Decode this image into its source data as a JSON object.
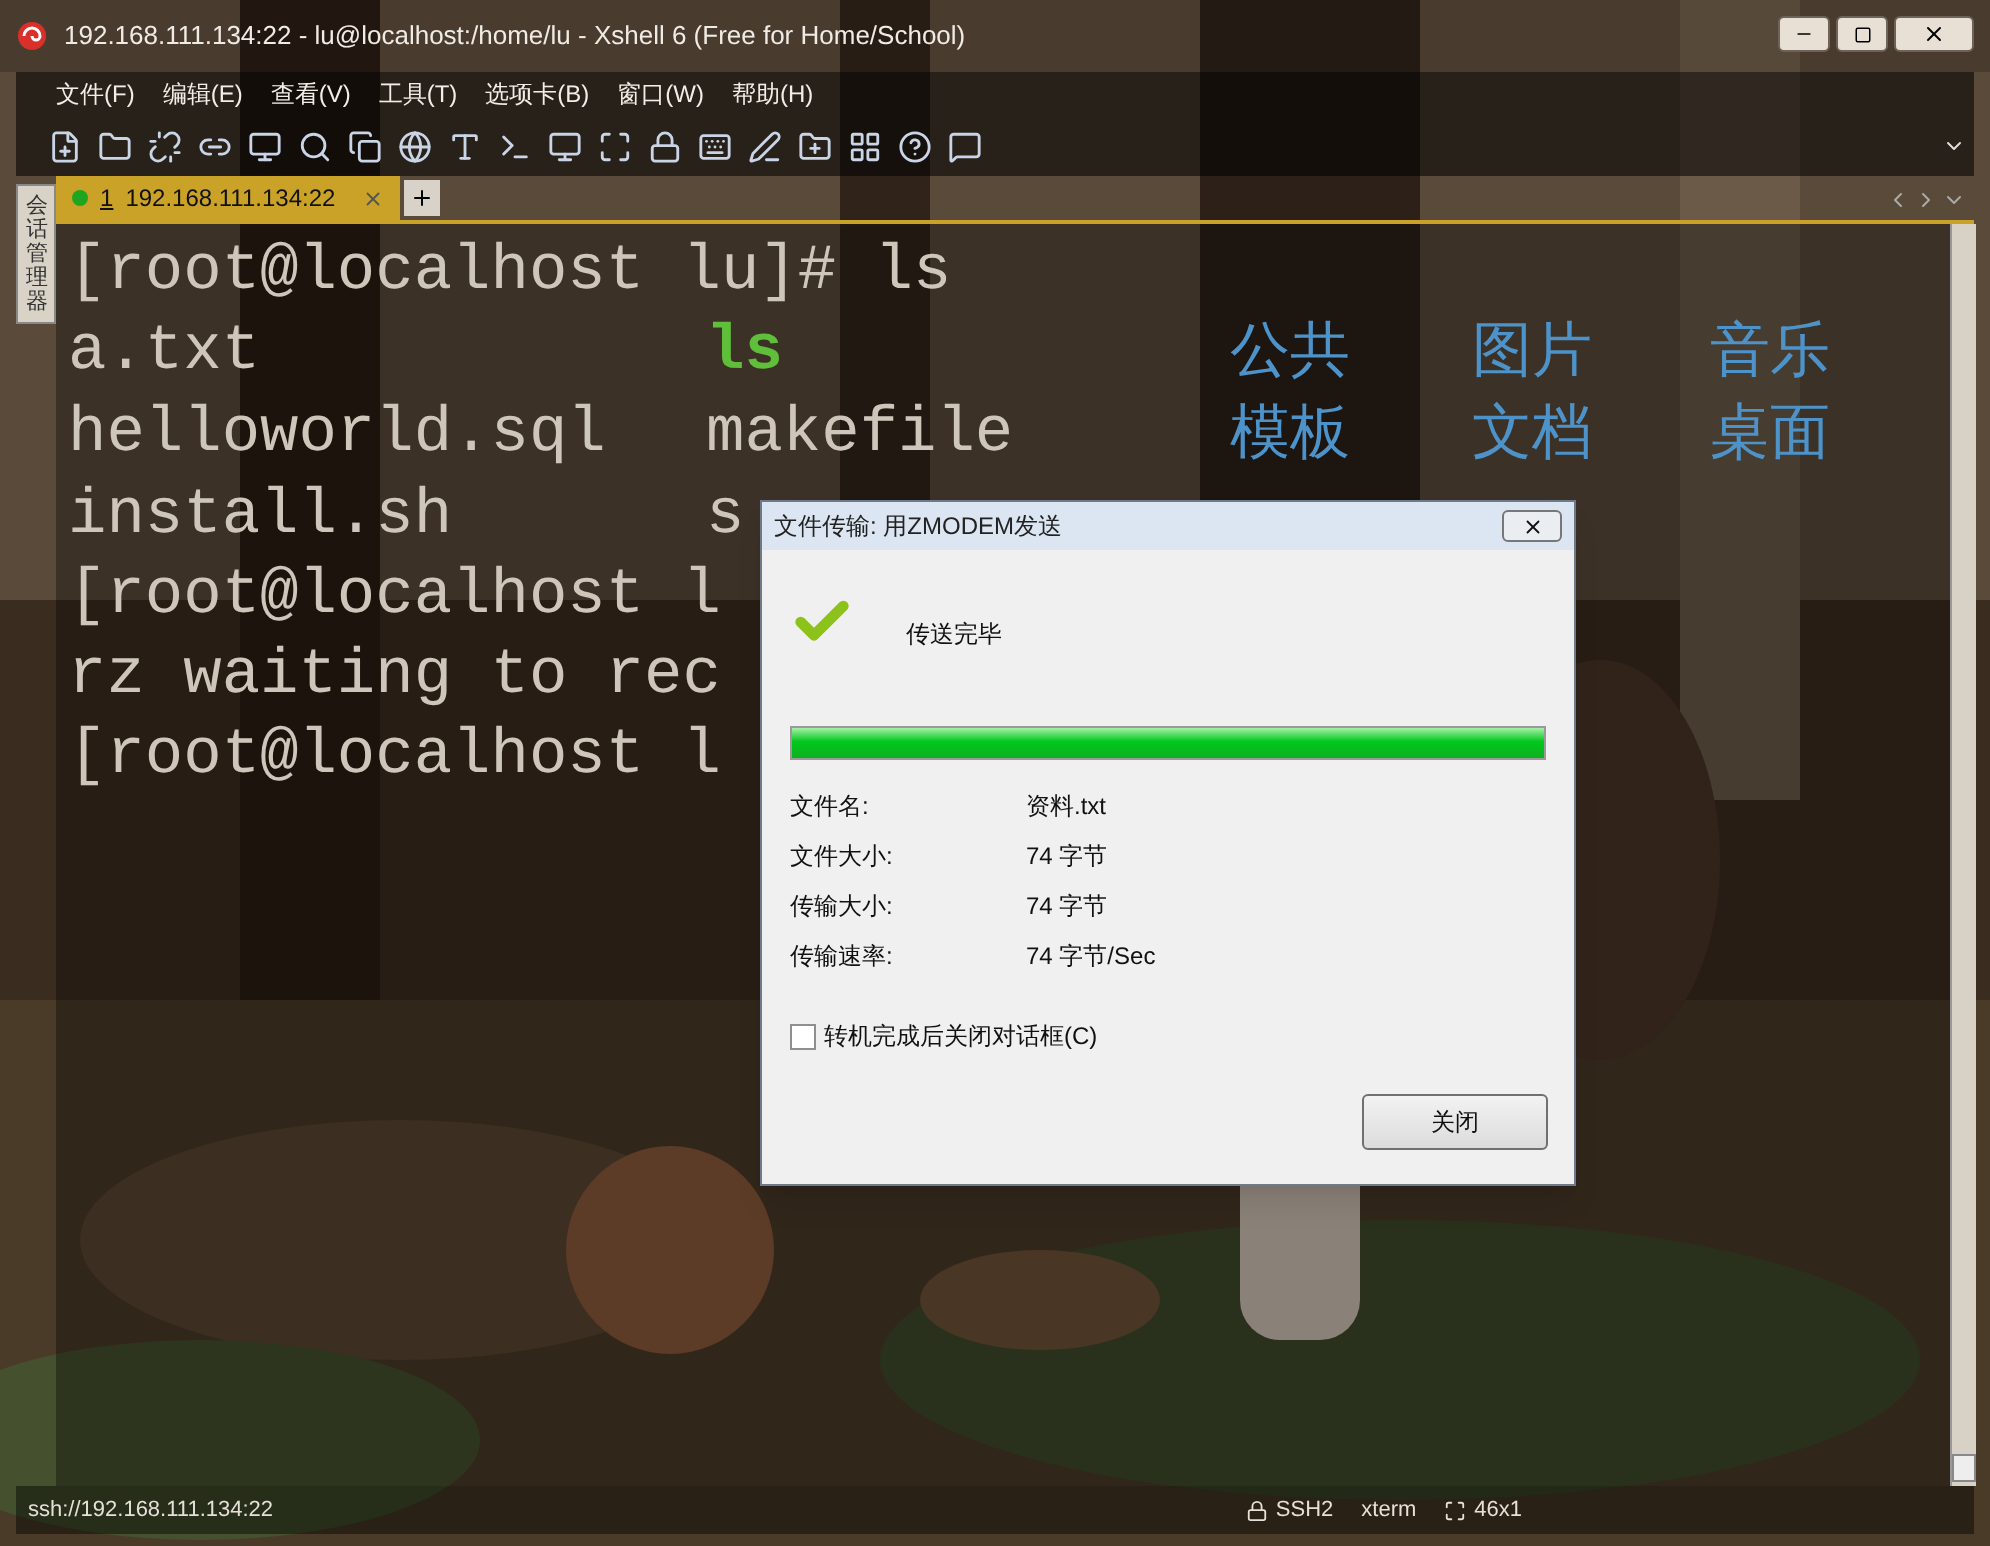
{
  "window": {
    "title": "192.168.111.134:22 - lu@localhost:/home/lu - Xshell 6 (Free for Home/School)"
  },
  "menu": [
    "文件(F)",
    "编辑(E)",
    "查看(V)",
    "工具(T)",
    "选项卡(B)",
    "窗口(W)",
    "帮助(H)"
  ],
  "tabs": [
    {
      "number": "1",
      "label": "192.168.111.134:22",
      "selected": true,
      "connected": true
    }
  ],
  "side_panel": {
    "label": "会话管理器"
  },
  "terminal": {
    "lines": [
      [
        {
          "text": "[root@localhost lu]# ls",
          "kind": "plain"
        }
      ],
      [
        {
          "text": "a.txt",
          "kind": "plain"
        },
        {
          "text": "ls",
          "kind": "exec"
        },
        {
          "text": "公共",
          "kind": "dir"
        },
        {
          "text": "图片",
          "kind": "dir"
        },
        {
          "text": "音乐",
          "kind": "dir"
        }
      ],
      [
        {
          "text": "helloworld.sql",
          "kind": "plain"
        },
        {
          "text": "makefile",
          "kind": "plain"
        },
        {
          "text": "模板",
          "kind": "dir"
        },
        {
          "text": "文档",
          "kind": "dir"
        },
        {
          "text": "桌面",
          "kind": "dir"
        }
      ],
      [
        {
          "text": "install.sh",
          "kind": "plain"
        },
        {
          "text": "s",
          "kind": "plain"
        }
      ],
      [
        {
          "text": "[root@localhost l",
          "kind": "plain"
        }
      ],
      [
        {
          "text": "rz waiting to rec",
          "kind": "plain"
        }
      ],
      [
        {
          "text": "[root@localhost l",
          "kind": "plain"
        }
      ]
    ]
  },
  "dialog": {
    "title": "文件传输: 用ZMODEM发送",
    "status": "传送完毕",
    "progress": {
      "level": 1.0
    },
    "fields": [
      {
        "label": "文件名:",
        "value": "资料.txt"
      },
      {
        "label": "文件大小:",
        "value": "74 字节"
      },
      {
        "label": "传输大小:",
        "value": "74 字节"
      },
      {
        "label": "传输速率:",
        "value": "74 字节/Sec"
      }
    ],
    "close_when_done": {
      "label": "转机完成后关闭对话框(C)",
      "checked": false
    },
    "button": "关闭"
  },
  "status_bar": [
    "ssh://192.168.111.134:22",
    "SSH2",
    "xterm",
    "46x1"
  ]
}
